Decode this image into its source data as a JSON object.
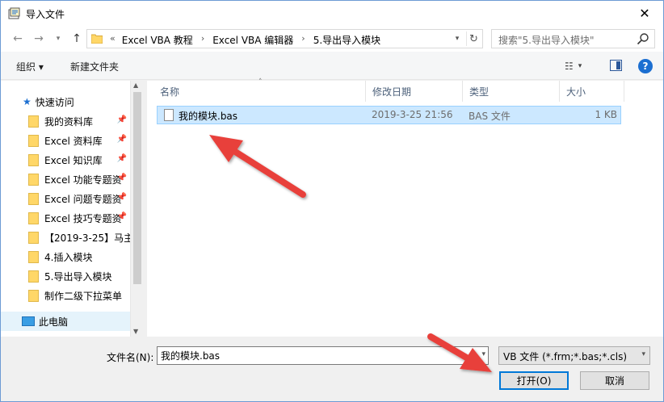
{
  "window": {
    "title": "导入文件",
    "close_glyph": "✕"
  },
  "nav": {
    "back_glyph": "←",
    "forward_glyph": "→",
    "history_glyph": "▾",
    "up_glyph": "↑"
  },
  "address": {
    "breadcrumbs": [
      "«",
      "Excel VBA 教程",
      "Excel VBA 编辑器",
      "5.导出导入模块"
    ],
    "dropdown_glyph": "▾",
    "refresh_glyph": "↻"
  },
  "search": {
    "placeholder": "搜索\"5.导出导入模块\""
  },
  "toolbar": {
    "organize_label": "组织 ▾",
    "new_folder_label": "新建文件夹",
    "view_glyph": "☷",
    "view_dd_glyph": "▾",
    "help_glyph": "?"
  },
  "navpane": {
    "quick_access": "快速访问",
    "items": [
      {
        "label": "我的资料库",
        "pinned": true
      },
      {
        "label": "Excel 资料库",
        "pinned": true
      },
      {
        "label": "Excel 知识库",
        "pinned": true
      },
      {
        "label": "Excel 功能专题资",
        "pinned": true
      },
      {
        "label": "Excel 问题专题资",
        "pinned": true
      },
      {
        "label": "Excel 技巧专题资",
        "pinned": true
      },
      {
        "label": "【2019-3-25】马主",
        "pinned": false
      },
      {
        "label": "4.插入模块",
        "pinned": false
      },
      {
        "label": "5.导出导入模块",
        "pinned": false
      },
      {
        "label": "制作二级下拉菜单",
        "pinned": false
      }
    ],
    "this_pc": "此电脑",
    "pin_glyph": "📌"
  },
  "filelist": {
    "columns": {
      "name": "名称",
      "date": "修改日期",
      "type": "类型",
      "size": "大小"
    },
    "sort_glyph": "˄",
    "rows": [
      {
        "name": "我的模块.bas",
        "date": "2019-3-25 21:56",
        "type": "BAS 文件",
        "size": "1 KB"
      }
    ]
  },
  "bottom": {
    "filename_label": "文件名(N):",
    "filename_value": "我的模块.bas",
    "filetype_value": "VB 文件 (*.frm;*.bas;*.cls)",
    "dd_glyph": "▾",
    "open_label": "打开(O)",
    "cancel_label": "取消"
  },
  "colors": {
    "selection_bg": "#cce8ff",
    "selection_border": "#99d1ff",
    "annotation_arrow": "#e8403a",
    "accent": "#0078d7"
  }
}
